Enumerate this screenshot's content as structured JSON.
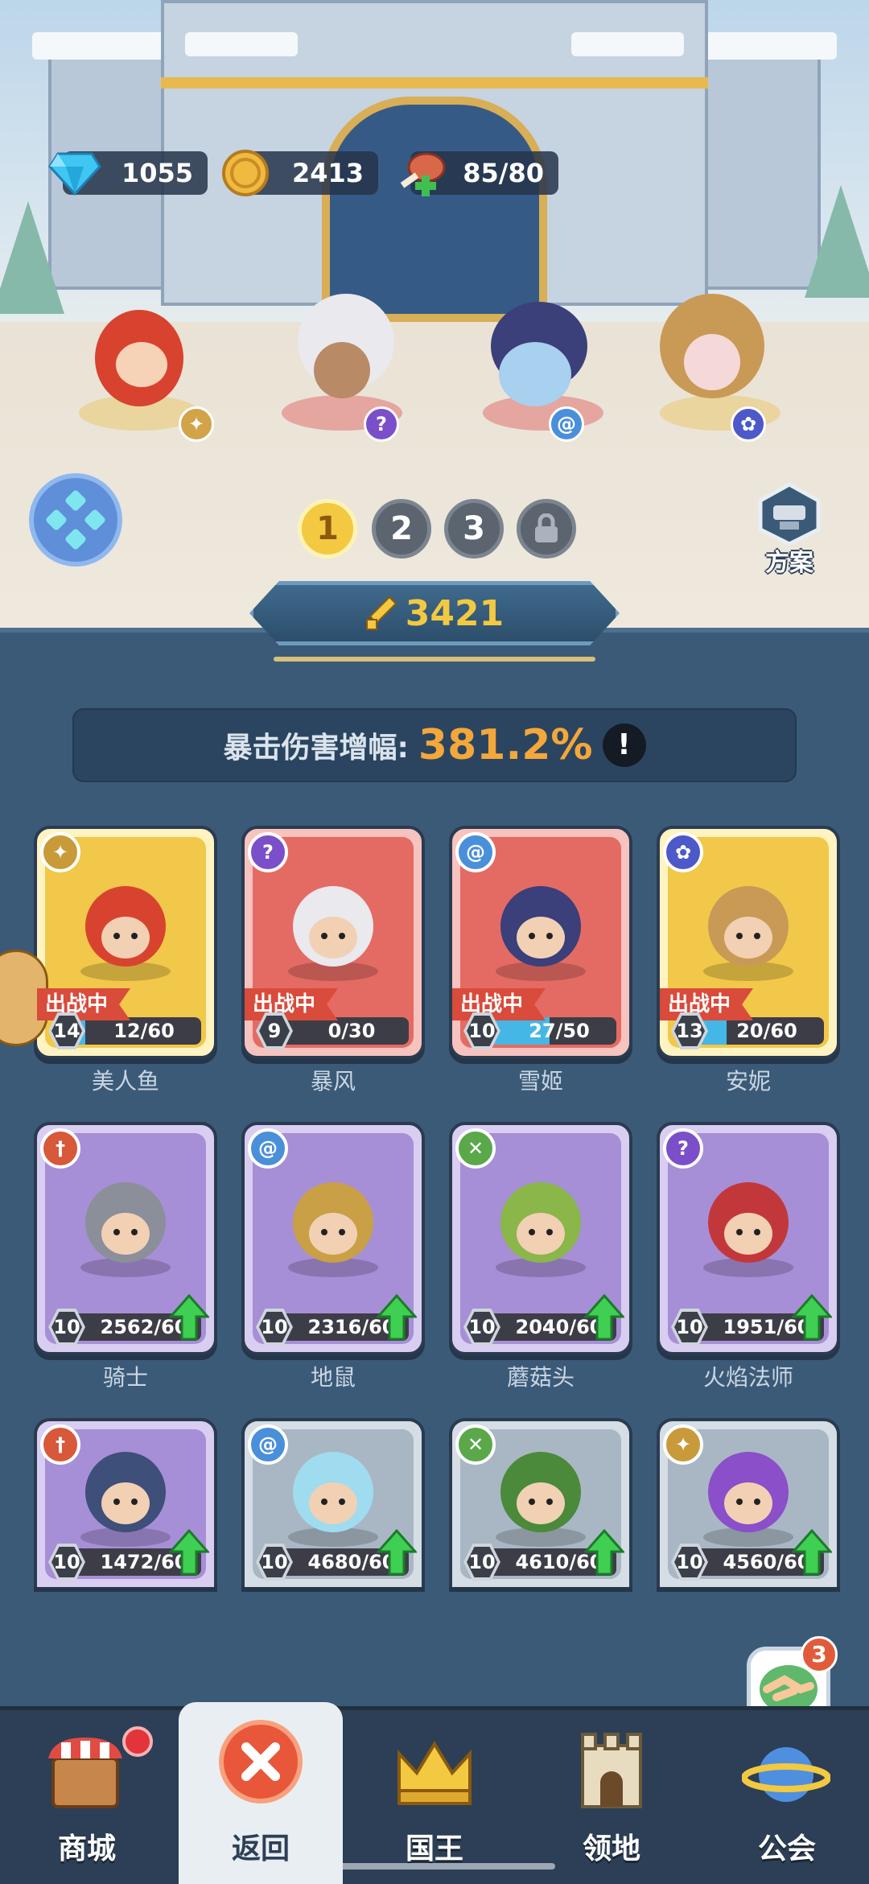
{
  "resources": {
    "gems": "1055",
    "coins": "2413",
    "stamina": "85/80"
  },
  "team": {
    "slots": [
      "1",
      "2",
      "3"
    ],
    "active_slot": "1",
    "preset_label": "方案"
  },
  "power": "3421",
  "crit": {
    "label": "暴击伤害增幅:",
    "value": "381.2%",
    "info_symbol": "!"
  },
  "deployed_tag": "出战中",
  "heroes": [
    {
      "name": "美人鱼",
      "level": "14",
      "progress": "12/60",
      "fill": 0.2,
      "class": "wing",
      "deployed": true,
      "rarity": "gold"
    },
    {
      "name": "暴风",
      "level": "9",
      "progress": "0/30",
      "fill": 0.0,
      "class": "magic",
      "deployed": true,
      "rarity": "red"
    },
    {
      "name": "雪姬",
      "level": "10",
      "progress": "27/50",
      "fill": 0.54,
      "class": "swirl",
      "deployed": true,
      "rarity": "red"
    },
    {
      "name": "安妮",
      "level": "13",
      "progress": "20/60",
      "fill": 0.33,
      "class": "paw",
      "deployed": true,
      "rarity": "gold"
    },
    {
      "name": "骑士",
      "level": "10",
      "progress": "2562/60",
      "fill": 1.0,
      "class": "sword",
      "deployed": false,
      "rarity": "purple"
    },
    {
      "name": "地鼠",
      "level": "10",
      "progress": "2316/60",
      "fill": 1.0,
      "class": "swirl",
      "deployed": false,
      "rarity": "purple"
    },
    {
      "name": "蘑菇头",
      "level": "10",
      "progress": "2040/60",
      "fill": 1.0,
      "class": "bow",
      "deployed": false,
      "rarity": "purple"
    },
    {
      "name": "火焰法师",
      "level": "10",
      "progress": "1951/60",
      "fill": 1.0,
      "class": "magic",
      "deployed": false,
      "rarity": "purple"
    },
    {
      "name": "",
      "level": "10",
      "progress": "1472/60",
      "fill": 1.0,
      "class": "sword",
      "deployed": false,
      "rarity": "purple"
    },
    {
      "name": "",
      "level": "10",
      "progress": "4680/60",
      "fill": 1.0,
      "class": "swirl",
      "deployed": false,
      "rarity": "blue"
    },
    {
      "name": "",
      "level": "10",
      "progress": "4610/60",
      "fill": 1.0,
      "class": "bow",
      "deployed": false,
      "rarity": "blue"
    },
    {
      "name": "",
      "level": "10",
      "progress": "4560/60",
      "fill": 1.0,
      "class": "wing",
      "deployed": false,
      "rarity": "blue"
    }
  ],
  "guild_badge": "3",
  "nav": {
    "shop": "商城",
    "back": "返回",
    "king": "国王",
    "territory": "领地",
    "guild": "公会"
  },
  "colors": {
    "gold_card": "#f1c84a",
    "red_card": "#e46b63",
    "purple_card": "#a68fd6",
    "blue_card": "#a9b7c4",
    "accent_orange": "#f4a73a",
    "panel": "#3b5a78"
  }
}
